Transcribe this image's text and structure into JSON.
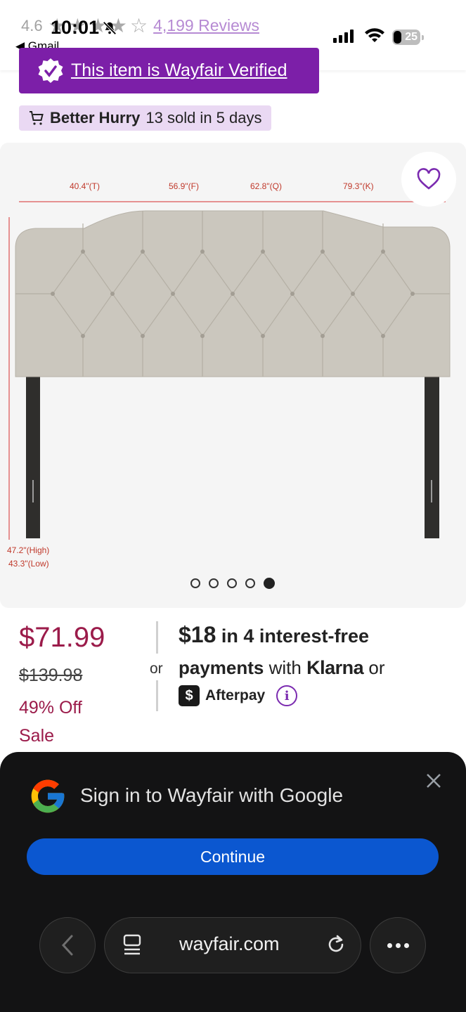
{
  "status_bar": {
    "time": "10:01",
    "back_app": "◀ Gmail",
    "battery": "25"
  },
  "rating": {
    "value": "4.6",
    "stars": 4.5,
    "reviews_link": "4,199 Reviews"
  },
  "verified_banner": {
    "text": "This item is Wayfair Verified"
  },
  "urgency": {
    "bold": "Better Hurry",
    "text": "13 sold in 5 days"
  },
  "gallery": {
    "dimension_labels": {
      "twin": "40.4\"(T)",
      "full": "56.9\"(F)",
      "queen": "62.8\"(Q)",
      "king": "79.3\"(K)",
      "high": "47.2\"(High)",
      "low": "43.3\"(Low)"
    },
    "slide_count": 5,
    "active_slide": 5
  },
  "pricing": {
    "price": "$71.99",
    "was_price": "$139.98",
    "discount": "49% Off",
    "badge": "Sale",
    "or": "or",
    "installment_amount": "$18",
    "installment_text": "in 4 interest-free",
    "payments_word": "payments",
    "with": "with",
    "klarna": "Klarna",
    "or2": "or",
    "afterpay": "Afterpay"
  },
  "google_sheet": {
    "title": "Sign in to Wayfair with Google",
    "continue": "Continue"
  },
  "browser": {
    "url": "wayfair.com"
  },
  "colors": {
    "brand_purple": "#7c1fa8",
    "price_red": "#9b1b4a",
    "google_blue": "#0b57d0"
  }
}
